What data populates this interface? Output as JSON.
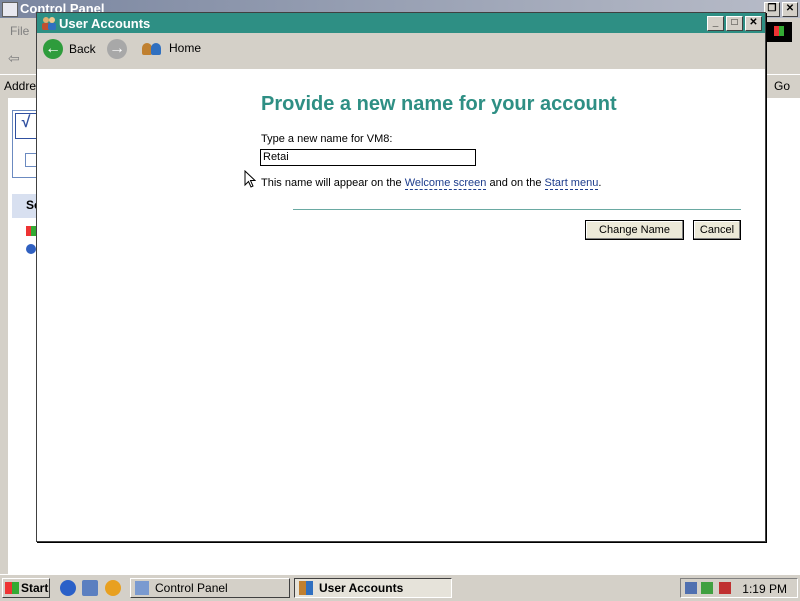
{
  "control_panel": {
    "title": "Control Panel",
    "menu_file": "File",
    "address_label": "Addre",
    "go_label": "Go",
    "partial_section_letter": "Se"
  },
  "user_accounts": {
    "title": "User Accounts",
    "toolbar": {
      "back_label": "Back",
      "home_label": "Home"
    },
    "heading": "Provide a new name for your account",
    "prompt": "Type a new name for VM8:",
    "name_value": "Retai",
    "info_prefix": "This name will appear on the ",
    "info_link1": "Welcome screen",
    "info_mid": " and on the ",
    "info_link2": "Start menu",
    "info_suffix": ".",
    "buttons": {
      "change_name": "Change Name",
      "cancel": "Cancel"
    },
    "window_controls": [
      "minimize",
      "maximize",
      "close"
    ]
  },
  "taskbar": {
    "start_label": "Start",
    "tasks": [
      {
        "label": "Control Panel",
        "active": false
      },
      {
        "label": "User Accounts",
        "active": true
      }
    ],
    "clock": "1:19 PM"
  },
  "colors": {
    "accent_teal": "#2e8f84",
    "link_blue": "#1c3c8c"
  }
}
